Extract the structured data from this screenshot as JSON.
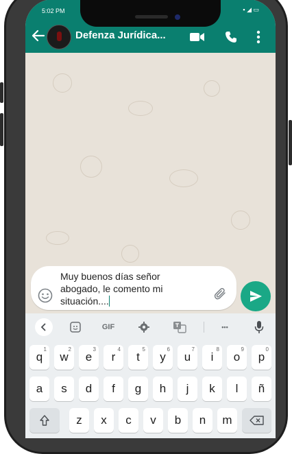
{
  "status": {
    "time": "5:02 PM",
    "icons": "▪ ◢ ▭"
  },
  "header": {
    "title": "Defenza Jurídica...",
    "bg": "#0a7f6f"
  },
  "composer": {
    "line1": "Muy buenos días señor",
    "line2": "abogado, le comento mi",
    "line3": "situación...."
  },
  "keyboard": {
    "toolbar": {
      "gif": "GIF",
      "more": "•••"
    },
    "row1": [
      "q",
      "w",
      "e",
      "r",
      "t",
      "y",
      "u",
      "i",
      "o",
      "p"
    ],
    "row1_hints": [
      "1",
      "2",
      "3",
      "4",
      "5",
      "6",
      "7",
      "8",
      "9",
      "0"
    ],
    "row2": [
      "a",
      "s",
      "d",
      "f",
      "g",
      "h",
      "j",
      "k",
      "l",
      "ñ"
    ],
    "row3": [
      "z",
      "x",
      "c",
      "v",
      "b",
      "n",
      "m"
    ]
  },
  "colors": {
    "accent": "#0a7f6f",
    "send": "#1aa886",
    "chat_bg": "#e8e2d9"
  }
}
